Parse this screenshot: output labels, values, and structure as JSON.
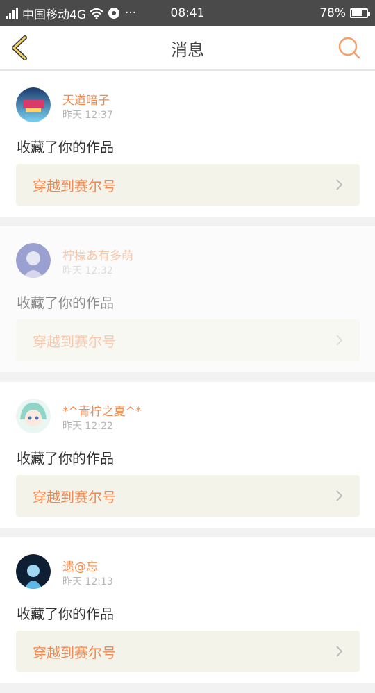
{
  "status_bar": {
    "carrier": "中国移动4G",
    "extra": "···",
    "time": "08:41",
    "battery": "78%",
    "battery_level": 0.78
  },
  "header": {
    "title": "消息",
    "back_icon": "chevron-left-icon",
    "search_icon": "search-icon"
  },
  "colors": {
    "accent": "#f08a50",
    "link_bg": "#f3f3ea"
  },
  "messages": [
    {
      "user": "天道暗子",
      "time": "昨天 12:37",
      "action": "收藏了你的作品",
      "work": "穿越到赛尔号"
    },
    {
      "user": "柠檬あ有多萌",
      "time": "昨天 12:32",
      "action": "收藏了你的作品",
      "work": "穿越到赛尔号"
    },
    {
      "user": "*^青柠之夏^*",
      "time": "昨天 12:22",
      "action": "收藏了你的作品",
      "work": "穿越到赛尔号"
    },
    {
      "user": "遗@忘",
      "time": "昨天 12:13",
      "action": "收藏了你的作品",
      "work": "穿越到赛尔号"
    }
  ]
}
